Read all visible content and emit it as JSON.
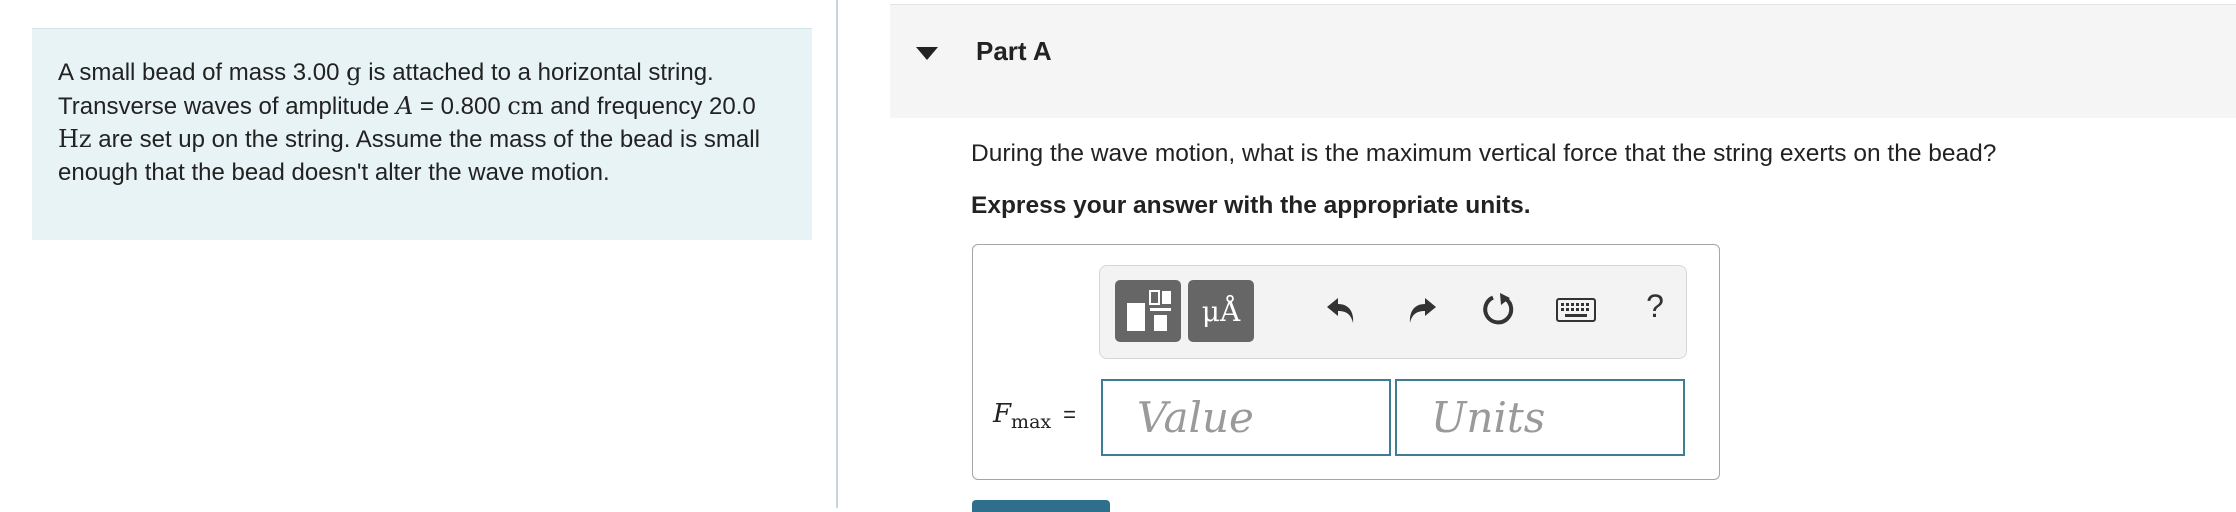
{
  "problem": {
    "text_part1": "A small bead of mass 3.00 ",
    "mass_unit": "g",
    "text_part2": " is attached to a horizontal string. Transverse waves of amplitude ",
    "amp_symbol": "A",
    "amp_eq": " = 0.800 ",
    "amp_unit": "cm",
    "text_part3": " and frequency 20.0 ",
    "freq_unit": "Hz",
    "text_part4": " are set up on the string. Assume the mass of the bead is small enough that the bead doesn't alter the wave motion."
  },
  "part": {
    "title": "Part A",
    "question": "During the wave motion, what is the maximum vertical force that the string exerts on the bead?",
    "instruction": "Express your answer with the appropriate units."
  },
  "toolbar": {
    "units_label": "μÅ",
    "help_label": "?"
  },
  "answer": {
    "symbol": "F",
    "subscript": "max",
    "equals": "=",
    "value_placeholder": "Value",
    "units_placeholder": "Units"
  },
  "colors": {
    "panel_bg": "#e8f3f6",
    "field_border": "#3f7d93",
    "button_dark": "#666666",
    "submit": "#2f6f8e"
  }
}
